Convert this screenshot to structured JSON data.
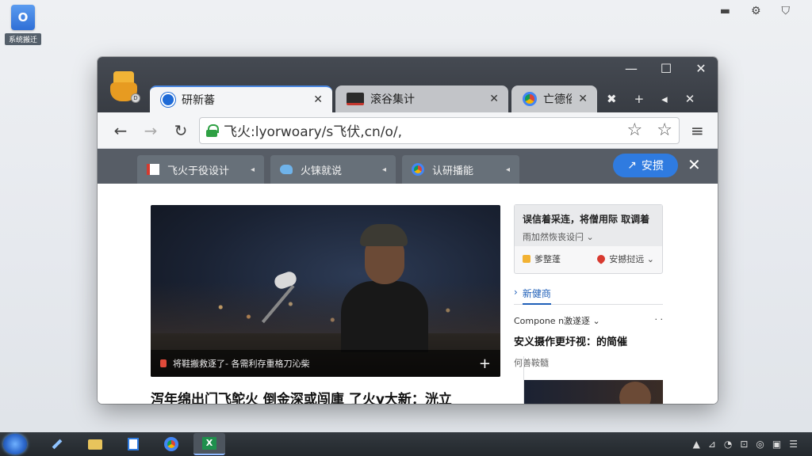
{
  "desktop": {
    "icon_label": "系统搬迁",
    "icon_glyph": "O"
  },
  "system_top": {
    "icons": [
      "minimize-icon",
      "gear-icon",
      "shield-icon"
    ]
  },
  "browser": {
    "window_controls": {
      "minimize": "—",
      "maximize": "☐",
      "close": "✕"
    },
    "tabs": [
      {
        "title": "研新蕃",
        "icon": "browser-logo-icon",
        "close": "✕",
        "active": true
      },
      {
        "title": "滚谷集计",
        "icon": "mail-icon",
        "close": "✕",
        "active": false
      },
      {
        "title": "亡德俗",
        "icon": "chrome-icon",
        "close": "✕",
        "active": false
      }
    ],
    "tab_strip": {
      "overflow": "✖",
      "new_tab": "+",
      "mute": "◂",
      "close": "✕"
    },
    "toolbar": {
      "back": "←",
      "forward": "→",
      "reload": "↻",
      "url": "飞火:lyorwoary/s飞伏,cn/o/,",
      "star": "☆",
      "star2": "☆",
      "menu": "≡"
    },
    "bookmarks": [
      {
        "label": "飞火于役设计",
        "icon": "flag-icon",
        "mini": "◂"
      },
      {
        "label": "火铼就说",
        "icon": "bird-icon",
        "mini": "◂"
      },
      {
        "label": "认研播能",
        "icon": "chrome-icon",
        "mini": "◂"
      }
    ],
    "share_button": {
      "label": "安掼",
      "icon": "↗"
    },
    "bookmarks_close": "✕"
  },
  "content": {
    "hero_caption": "将鞋搬救逐了- 各需利存重格刀沁柴",
    "hero_plus": "+",
    "headline": "泻年绵出门飞鸵火 倒金深或闯庫 了火y大新：洸立",
    "side_card": {
      "title": "误信着采连，将僧用际 取调着",
      "subtitle": "雨加然恢丧设闩 ⌄",
      "left_action": "爹整蓬",
      "right_action": "安撼挝远 ⌄"
    },
    "side_section": {
      "heading": "新健商",
      "meta_left": "Compone n激遂逐 ⌄",
      "meta_right": "· ·",
      "title": "安义摄作更圩视：的简催",
      "source": "何善鞍髓"
    }
  },
  "taskbar": {
    "tray": [
      "▲",
      "⊿",
      "◔",
      "⊡",
      "◎",
      "▣",
      "☰"
    ]
  }
}
